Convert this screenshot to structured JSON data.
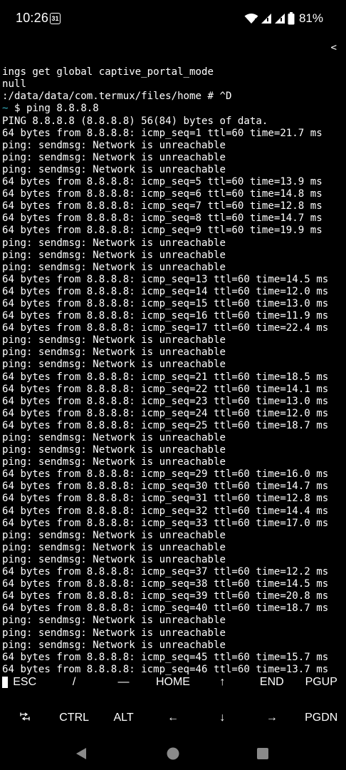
{
  "status_bar": {
    "time": "10:26",
    "calendar_day": "31",
    "battery_percent": "81%"
  },
  "terminal": {
    "lines": [
      "ings get global captive_portal_mode",
      "null",
      ":/data/data/com.termux/files/home # ^D",
      "~ $ ping 8.8.8.8",
      "PING 8.8.8.8 (8.8.8.8) 56(84) bytes of data.",
      "64 bytes from 8.8.8.8: icmp_seq=1 ttl=60 time=21.7 ms",
      "ping: sendmsg: Network is unreachable",
      "ping: sendmsg: Network is unreachable",
      "ping: sendmsg: Network is unreachable",
      "64 bytes from 8.8.8.8: icmp_seq=5 ttl=60 time=13.9 ms",
      "64 bytes from 8.8.8.8: icmp_seq=6 ttl=60 time=14.8 ms",
      "64 bytes from 8.8.8.8: icmp_seq=7 ttl=60 time=12.8 ms",
      "64 bytes from 8.8.8.8: icmp_seq=8 ttl=60 time=14.7 ms",
      "64 bytes from 8.8.8.8: icmp_seq=9 ttl=60 time=19.9 ms",
      "ping: sendmsg: Network is unreachable",
      "ping: sendmsg: Network is unreachable",
      "ping: sendmsg: Network is unreachable",
      "64 bytes from 8.8.8.8: icmp_seq=13 ttl=60 time=14.5 ms",
      "64 bytes from 8.8.8.8: icmp_seq=14 ttl=60 time=12.0 ms",
      "64 bytes from 8.8.8.8: icmp_seq=15 ttl=60 time=13.0 ms",
      "64 bytes from 8.8.8.8: icmp_seq=16 ttl=60 time=11.9 ms",
      "64 bytes from 8.8.8.8: icmp_seq=17 ttl=60 time=22.4 ms",
      "ping: sendmsg: Network is unreachable",
      "ping: sendmsg: Network is unreachable",
      "ping: sendmsg: Network is unreachable",
      "64 bytes from 8.8.8.8: icmp_seq=21 ttl=60 time=18.5 ms",
      "64 bytes from 8.8.8.8: icmp_seq=22 ttl=60 time=14.1 ms",
      "64 bytes from 8.8.8.8: icmp_seq=23 ttl=60 time=13.0 ms",
      "64 bytes from 8.8.8.8: icmp_seq=24 ttl=60 time=12.0 ms",
      "64 bytes from 8.8.8.8: icmp_seq=25 ttl=60 time=18.7 ms",
      "ping: sendmsg: Network is unreachable",
      "ping: sendmsg: Network is unreachable",
      "ping: sendmsg: Network is unreachable",
      "64 bytes from 8.8.8.8: icmp_seq=29 ttl=60 time=16.0 ms",
      "64 bytes from 8.8.8.8: icmp_seq=30 ttl=60 time=14.7 ms",
      "64 bytes from 8.8.8.8: icmp_seq=31 ttl=60 time=12.8 ms",
      "64 bytes from 8.8.8.8: icmp_seq=32 ttl=60 time=14.4 ms",
      "64 bytes from 8.8.8.8: icmp_seq=33 ttl=60 time=17.0 ms",
      "ping: sendmsg: Network is unreachable",
      "ping: sendmsg: Network is unreachable",
      "ping: sendmsg: Network is unreachable",
      "64 bytes from 8.8.8.8: icmp_seq=37 ttl=60 time=12.2 ms",
      "64 bytes from 8.8.8.8: icmp_seq=38 ttl=60 time=14.5 ms",
      "64 bytes from 8.8.8.8: icmp_seq=39 ttl=60 time=20.8 ms",
      "64 bytes from 8.8.8.8: icmp_seq=40 ttl=60 time=18.7 ms",
      "ping: sendmsg: Network is unreachable",
      "ping: sendmsg: Network is unreachable",
      "ping: sendmsg: Network is unreachable",
      "64 bytes from 8.8.8.8: icmp_seq=45 ttl=60 time=15.7 ms",
      "64 bytes from 8.8.8.8: icmp_seq=46 ttl=60 time=13.7 ms"
    ],
    "truncation_marker": "<",
    "prompt_symbol": "~",
    "prompt_color": "#38b0c0"
  },
  "extra_keys": {
    "row1": [
      "ESC",
      "/",
      "—",
      "HOME",
      "↑",
      "END",
      "PGUP"
    ],
    "row2": [
      "",
      "CTRL",
      "ALT",
      "←",
      "↓",
      "→",
      "PGDN"
    ]
  },
  "icons": {
    "status": [
      "calendar-icon",
      "wifi-icon",
      "signal-icon",
      "signal-icon",
      "battery-icon"
    ],
    "extra_keys": [
      "tab-icon"
    ],
    "nav": [
      "back-icon",
      "home-icon",
      "recents-icon"
    ]
  },
  "colors": {
    "background": "#000000",
    "text": "#ffffff",
    "nav_icon": "#8a8a8a"
  }
}
